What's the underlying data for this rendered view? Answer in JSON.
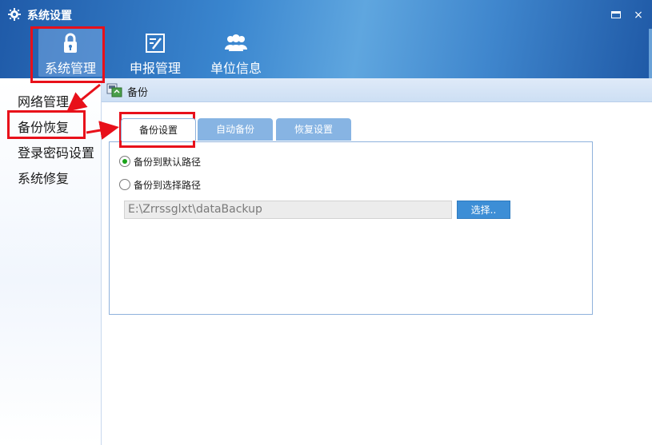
{
  "window": {
    "title": "系统设置",
    "icon": "gear-icon",
    "restore_icon": "restore-icon",
    "close_label": "×"
  },
  "top_nav": [
    {
      "label": "系统管理",
      "icon": "lock-icon",
      "selected": true
    },
    {
      "label": "申报管理",
      "icon": "edit-icon",
      "selected": false
    },
    {
      "label": "单位信息",
      "icon": "users-icon",
      "selected": false
    }
  ],
  "sidebar": {
    "items": [
      {
        "label": "网络管理"
      },
      {
        "label": "备份恢复",
        "selected": true
      },
      {
        "label": "登录密码设置"
      },
      {
        "label": "系统修复"
      }
    ]
  },
  "section": {
    "title": "备份",
    "icon": "backup-icon"
  },
  "tabs": [
    {
      "label": "备份设置",
      "active": true
    },
    {
      "label": "自动备份",
      "active": false
    },
    {
      "label": "恢复设置",
      "active": false
    }
  ],
  "backup": {
    "default_path_option": "备份到默认路径",
    "custom_path_option": "备份到选择路径",
    "selected_option": "default",
    "path_value": "E:\\Zrrssglxt\\dataBackup",
    "choose_button": "选择.."
  },
  "colors": {
    "header_blue": "#3a86cf",
    "highlight_red": "#e8101a",
    "tab_inactive": "#87b4e3",
    "button_blue": "#3d8ed6",
    "radio_selected": "#1aa31a"
  }
}
